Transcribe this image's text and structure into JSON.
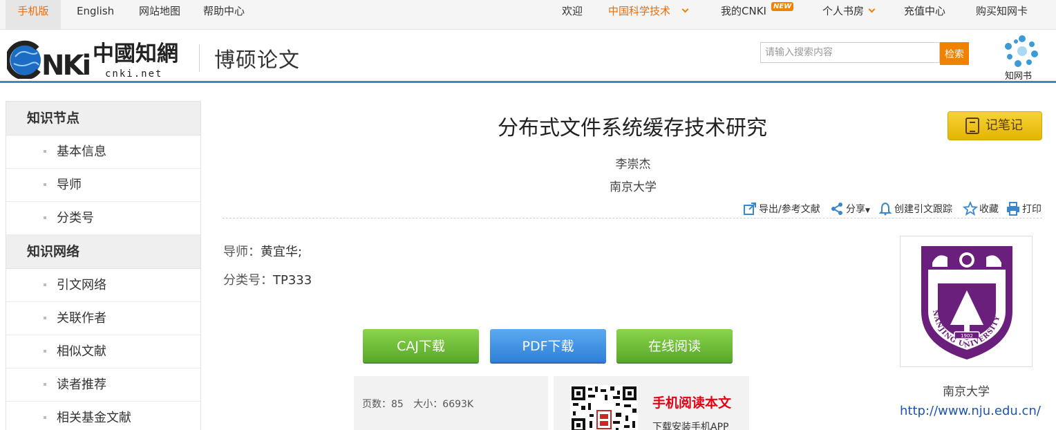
{
  "topbar": {
    "mobile": "手机版",
    "english": "English",
    "sitemap": "网站地图",
    "help": "帮助中心",
    "welcome": "欢迎",
    "cast": "中国科学技术",
    "mycnki": "我的CNKI",
    "new_badge": "NEW",
    "library": "个人书房",
    "recharge": "充值中心",
    "buy_card": "购买知网卡"
  },
  "header": {
    "logo_text": "中國知網",
    "logo_sub": "cnki.net",
    "section": "博硕论文",
    "search_placeholder": "请输入搜索内容",
    "search_button": "检索",
    "zwb_label": "知网书"
  },
  "sidebar": {
    "sections": [
      {
        "heading": "知识节点",
        "items": [
          "基本信息",
          "导师",
          "分类号"
        ]
      },
      {
        "heading": "知识网络",
        "items": [
          "引文网络",
          "关联作者",
          "相似文献",
          "读者推荐",
          "相关基金文献"
        ]
      }
    ]
  },
  "paper": {
    "title": "分布式文件系统缓存技术研究",
    "author": "李崇杰",
    "university": "南京大学",
    "note_button": "记笔记",
    "advisor_label": "导师：",
    "advisor": "黄宜华;",
    "class_label": "分类号：",
    "class_code": "TP333"
  },
  "toolbar": {
    "export": "导出/参考文献",
    "share": "分享",
    "track": "创建引文跟踪",
    "favorite": "收藏",
    "print": "打印"
  },
  "downloads": {
    "caj": "CAJ下载",
    "pdf": "PDF下载",
    "online": "在线阅读"
  },
  "info": {
    "pages_label": "页数：",
    "pages": "85",
    "size_label": "大小：",
    "size": "6693K"
  },
  "app": {
    "title": "手机阅读本文",
    "subtitle": "下载安装手机APP"
  },
  "institution": {
    "name": "南京大学",
    "url": "http://www.nju.edu.cn/",
    "seal_text": "NANJING UNIVERSITY",
    "seal_year": "1902"
  },
  "colors": {
    "accent_orange": "#f08200",
    "header_blue": "#3a87cf",
    "green_button": "#58a82a",
    "blue_button": "#2f7fd8",
    "purple_seal": "#6b1f7c",
    "app_red": "#e60012"
  }
}
